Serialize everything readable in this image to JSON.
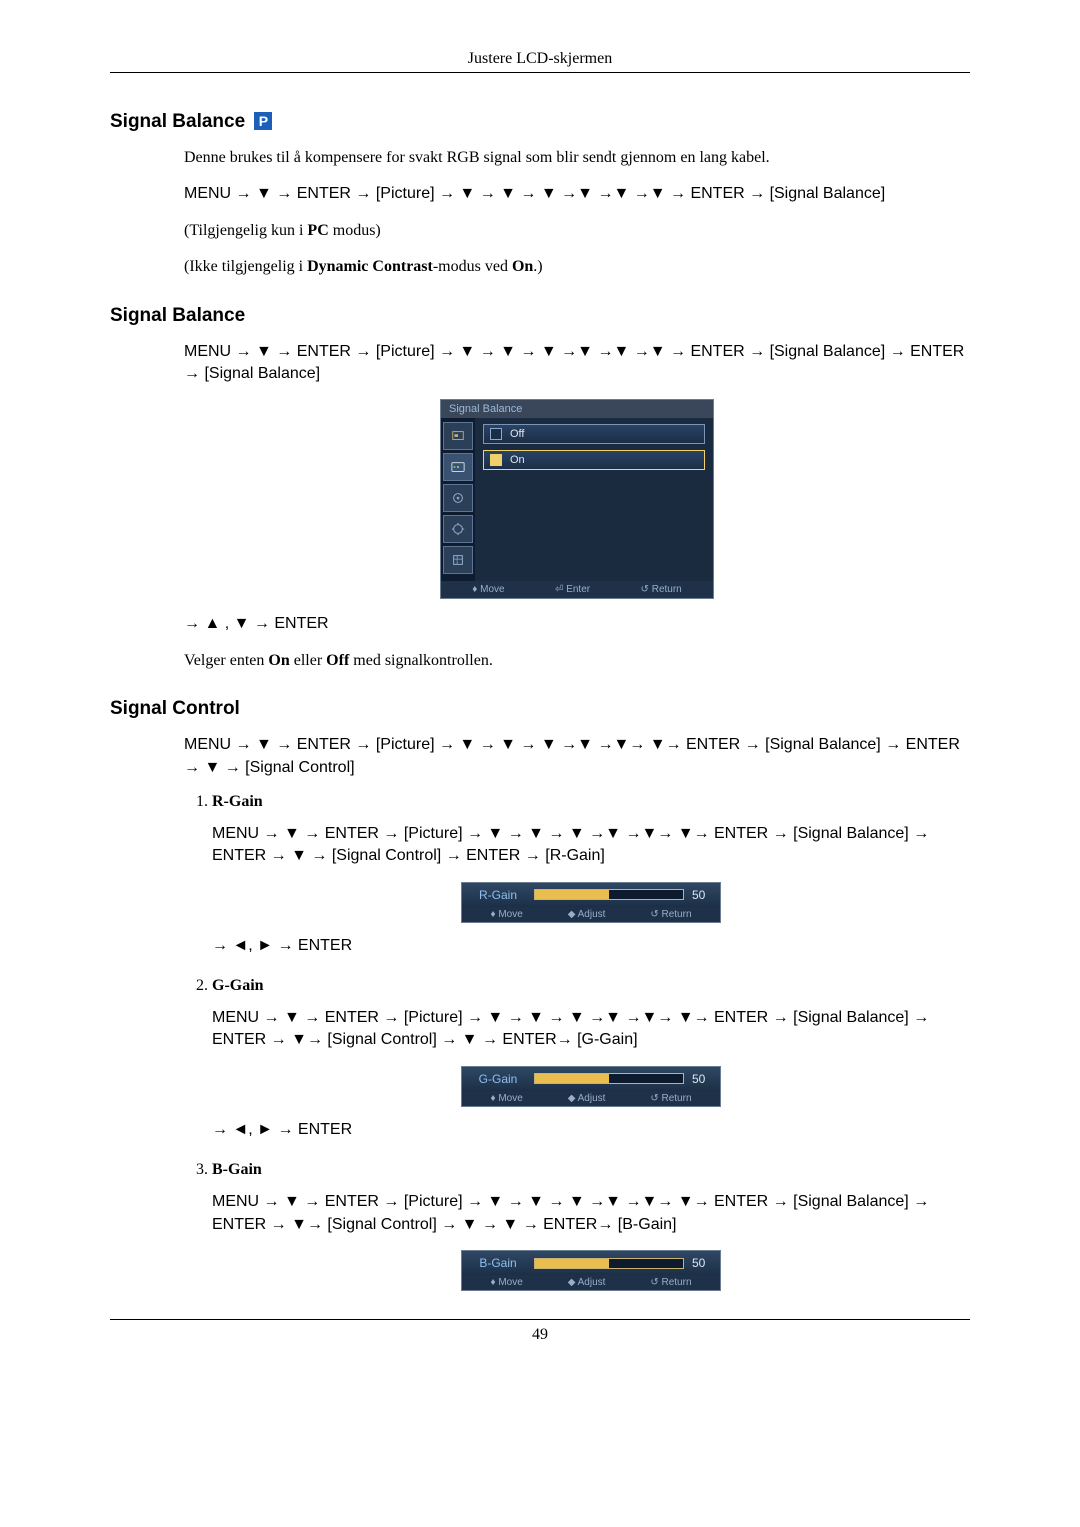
{
  "header": "Justere LCD-skjermen",
  "footer_page": "49",
  "icons": {
    "p": "P"
  },
  "hd": {
    "sb_p": "Signal Balance",
    "sb": "Signal Balance",
    "sc": "Signal Control"
  },
  "s1": {
    "desc": "Denne brukes til å kompensere for svakt RGB signal som blir sendt gjennom en lang kabel.",
    "path": "MENU → ▼ → ENTER → [Picture] → ▼ → ▼ → ▼ →▼ →▼ →▼ → ENTER → [Signal Balance]",
    "note1_pre": "(Tilgjengelig kun i ",
    "note1_b": "PC",
    "note1_post": " modus)",
    "note2_pre": "(Ikke tilgjengelig i ",
    "note2_b": "Dynamic Contrast",
    "note2_mid": "-modus ved ",
    "note2_b2": "On",
    "note2_post": ".)"
  },
  "s2": {
    "path": "MENU → ▼ → ENTER → [Picture] → ▼ → ▼ → ▼ →▼ →▼ →▼ → ENTER → [Signal Balance] → ENTER → [Signal Balance]",
    "nav": "→ ▲ , ▼ → ENTER",
    "desc_pre": "Velger enten ",
    "desc_b1": "On",
    "desc_mid": " eller ",
    "desc_b2": "Off",
    "desc_post": " med signalkontrollen."
  },
  "s3": {
    "path": "MENU → ▼ → ENTER → [Picture] → ▼ → ▼ → ▼ →▼ →▼→ ▼→ ENTER → [Signal Balance] → ENTER → ▼ → [Signal Control]",
    "items": {
      "r": {
        "name": "R-Gain",
        "path": "MENU → ▼ → ENTER → [Picture] → ▼ → ▼ → ▼ →▼ →▼→ ▼→ ENTER → [Signal Balance] → ENTER → ▼ → [Signal Control] → ENTER → [R-Gain]",
        "nav": "→ ◄, ► → ENTER"
      },
      "g": {
        "name": "G-Gain",
        "path": "MENU → ▼ → ENTER → [Picture] → ▼ → ▼ → ▼ →▼ →▼→ ▼→ ENTER → [Signal Balance] → ENTER → ▼→ [Signal Control] → ▼ → ENTER→ [G-Gain]",
        "nav": "→ ◄, ► → ENTER"
      },
      "b": {
        "name": "B-Gain",
        "path": "MENU → ▼ → ENTER → [Picture] → ▼ → ▼ → ▼ →▼ →▼→ ▼→ ENTER → [Signal Balance] → ENTER → ▼→ [Signal Control] → ▼ → ▼ → ENTER→ [B-Gain]"
      }
    }
  },
  "osd_main": {
    "title": "Signal Balance",
    "opt_off": "Off",
    "opt_on": "On",
    "foot_move": "Move",
    "foot_enter": "Enter",
    "foot_return": "Return"
  },
  "osd_small": {
    "foot_move": "Move",
    "foot_adjust": "Adjust",
    "foot_return": "Return"
  },
  "chart_data": [
    {
      "type": "bar",
      "label": "R-Gain",
      "value": 50,
      "range": [
        0,
        100
      ]
    },
    {
      "type": "bar",
      "label": "G-Gain",
      "value": 50,
      "range": [
        0,
        100
      ]
    },
    {
      "type": "bar",
      "label": "B-Gain",
      "value": 50,
      "range": [
        0,
        100
      ]
    }
  ]
}
